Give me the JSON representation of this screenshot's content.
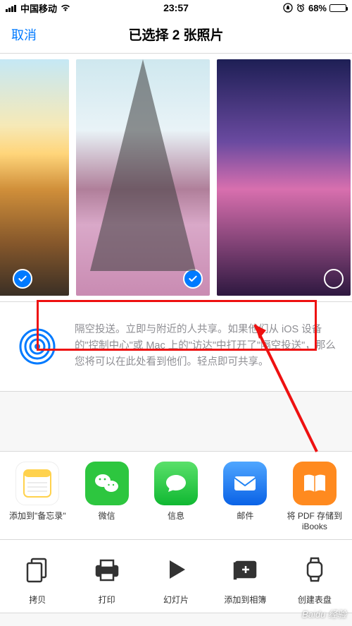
{
  "status": {
    "carrier": "中国移动",
    "time": "23:57",
    "battery_pct": "68%",
    "battery_fill": 68
  },
  "nav": {
    "cancel": "取消",
    "title": "已选择 2 张照片"
  },
  "photos": [
    {
      "selected": true
    },
    {
      "selected": true
    },
    {
      "selected": false
    }
  ],
  "airdrop": {
    "text": "隔空投送。立即与附近的人共享。如果他们从 iOS 设备的\"控制中心\"或 Mac 上的\"访达\"中打开了\"隔空投送\"，那么您将可以在此处看到他们。轻点即可共享。"
  },
  "apps": [
    {
      "label": "添加到\"备忘录\"",
      "color": "#ffffff",
      "stroke": "#ffd24d",
      "name": "notes"
    },
    {
      "label": "微信",
      "color": "#2dc63f",
      "name": "wechat"
    },
    {
      "label": "信息",
      "color": "#2bc84d",
      "name": "messages"
    },
    {
      "label": "邮件",
      "color": "#1f82f4",
      "name": "mail"
    },
    {
      "label": "将 PDF 存储到 iBooks",
      "color": "#ff8a1f",
      "name": "ibooks"
    }
  ],
  "actions": [
    {
      "label": "拷贝",
      "name": "copy"
    },
    {
      "label": "打印",
      "name": "print"
    },
    {
      "label": "幻灯片",
      "name": "slideshow"
    },
    {
      "label": "添加到相簿",
      "name": "add-to-album"
    },
    {
      "label": "创建表盘",
      "name": "create-watchface"
    }
  ],
  "watermark": "Baidu 经验"
}
